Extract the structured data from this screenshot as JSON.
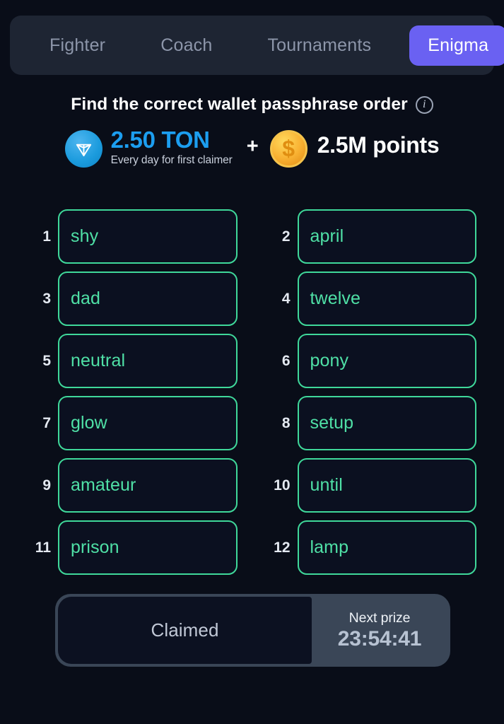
{
  "tabs": [
    {
      "label": "Fighter",
      "active": false
    },
    {
      "label": "Coach",
      "active": false
    },
    {
      "label": "Tournaments",
      "active": false
    },
    {
      "label": "Enigma",
      "active": true
    }
  ],
  "header": {
    "title": "Find the correct wallet passphrase order",
    "info_icon": "info-circle-icon"
  },
  "prize": {
    "ton_icon": "ton-coin-icon",
    "ton_amount": "2.50 TON",
    "ton_subtitle": "Every day for first claimer",
    "separator": "+",
    "points_icon": "gold-coin-icon",
    "points_amount": "2.5M points"
  },
  "words": [
    {
      "index": "1",
      "word": "shy"
    },
    {
      "index": "2",
      "word": "april"
    },
    {
      "index": "3",
      "word": "dad"
    },
    {
      "index": "4",
      "word": "twelve"
    },
    {
      "index": "5",
      "word": "neutral"
    },
    {
      "index": "6",
      "word": "pony"
    },
    {
      "index": "7",
      "word": "glow"
    },
    {
      "index": "8",
      "word": "setup"
    },
    {
      "index": "9",
      "word": "amateur"
    },
    {
      "index": "10",
      "word": "until"
    },
    {
      "index": "11",
      "word": "prison"
    },
    {
      "index": "12",
      "word": "lamp"
    }
  ],
  "footer": {
    "claim_label": "Claimed",
    "next_prize_label": "Next prize",
    "countdown": "23:54:41"
  },
  "colors": {
    "background": "#090d18",
    "tabbar": "#1e2533",
    "accent_active_tab": "#6a61f2",
    "word_border": "#3fd89a",
    "word_text": "#4fe0a6",
    "ton_blue": "#1c9ef0",
    "coin_gold": "#f9b233",
    "footer_bar": "#3a4657",
    "footer_inner": "#0c1121"
  }
}
